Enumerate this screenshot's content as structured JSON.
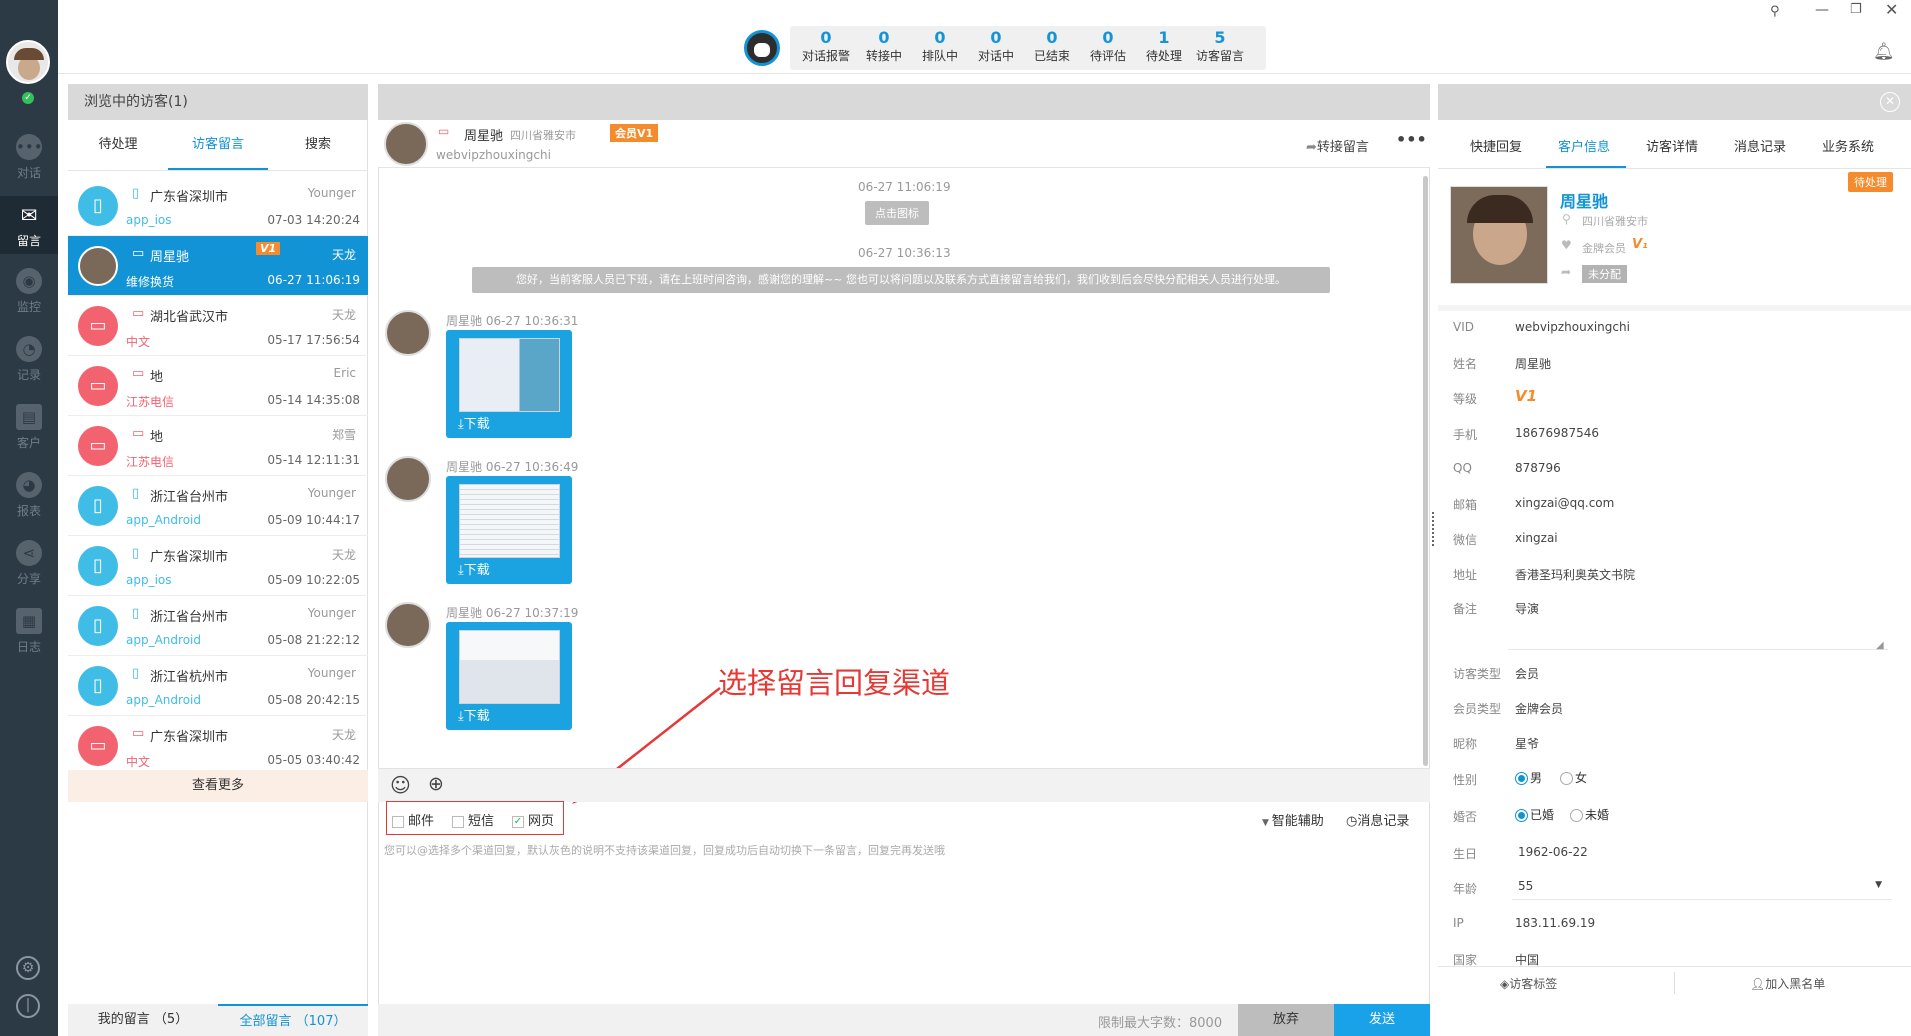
{
  "nav": {
    "items": [
      {
        "label": "对话",
        "icon": "chat-bubble-icon"
      },
      {
        "label": "留言",
        "icon": "mail-icon"
      },
      {
        "label": "监控",
        "icon": "eye-icon"
      },
      {
        "label": "记录",
        "icon": "clock-icon"
      },
      {
        "label": "客户",
        "icon": "contact-card-icon"
      },
      {
        "label": "报表",
        "icon": "pie-chart-icon"
      },
      {
        "label": "分享",
        "icon": "share-icon"
      },
      {
        "label": "日志",
        "icon": "clipboard-icon"
      }
    ]
  },
  "stats": [
    {
      "value": "0",
      "label": "对话报警"
    },
    {
      "value": "0",
      "label": "转接中"
    },
    {
      "value": "0",
      "label": "排队中"
    },
    {
      "value": "0",
      "label": "对话中"
    },
    {
      "value": "0",
      "label": "已结束"
    },
    {
      "value": "0",
      "label": "待评估"
    },
    {
      "value": "1",
      "label": "待处理"
    },
    {
      "value": "5",
      "label": "访客留言"
    }
  ],
  "left": {
    "header": "浏览中的访客(1)",
    "tabs": [
      "待处理",
      "访客留言",
      "搜索"
    ],
    "visitors": [
      {
        "device": "▯",
        "location": "广东省深圳市",
        "sub": "app_ios",
        "agent": "Younger",
        "time": "07-03 14:20:24",
        "type": "app"
      },
      {
        "device": "▭",
        "location": "周星驰",
        "sub": "维修换货",
        "agent": "天龙",
        "time": "06-27 11:06:19",
        "type": "photo",
        "badge": "V1"
      },
      {
        "device": "▭",
        "location": "湖北省武汉市",
        "sub": "中文",
        "agent": "天龙",
        "time": "05-17 17:56:54",
        "type": "pc"
      },
      {
        "device": "▭",
        "location": "地",
        "sub": "江苏电信",
        "agent": "Eric",
        "time": "05-14 14:35:08",
        "type": "pc"
      },
      {
        "device": "▭",
        "location": "地",
        "sub": "江苏电信",
        "agent": "郑雪",
        "time": "05-14 12:11:31",
        "type": "pc"
      },
      {
        "device": "▯",
        "location": "浙江省台州市",
        "sub": "app_Android",
        "agent": "Younger",
        "time": "05-09 10:44:17",
        "type": "app"
      },
      {
        "device": "▯",
        "location": "广东省深圳市",
        "sub": "app_ios",
        "agent": "天龙",
        "time": "05-09 10:22:05",
        "type": "app"
      },
      {
        "device": "▯",
        "location": "浙江省台州市",
        "sub": "app_Android",
        "agent": "Younger",
        "time": "05-08 21:22:12",
        "type": "app"
      },
      {
        "device": "▯",
        "location": "浙江省杭州市",
        "sub": "app_Android",
        "agent": "Younger",
        "time": "05-08 20:42:15",
        "type": "app"
      },
      {
        "device": "▭",
        "location": "广东省深圳市",
        "sub": "中文",
        "agent": "天龙",
        "time": "05-05 03:40:42",
        "type": "pc"
      }
    ],
    "more": "查看更多",
    "footer_mine": "我的留言 （5）",
    "footer_all": "全部留言 （107）"
  },
  "chat": {
    "name": "周星驰",
    "location": "四川省雅安市",
    "member_badge": "会员V1",
    "visitor_id": "webvipzhouxingchi",
    "transfer": "转接留言",
    "time1": "06-27 11:06:19",
    "click_icon": "点击图标",
    "time2": "06-27 10:36:13",
    "system_msg": "您好，当前客服人员已下班，请在上班时间咨询，感谢您的理解~~ 您也可以将问题以及联系方式直接留言给我们，我们收到后会尽快分配相关人员进行处理。",
    "messages": [
      {
        "sender": "周星驰 06-27 10:36:31",
        "download": "下载"
      },
      {
        "sender": "周星驰 06-27 10:36:49",
        "download": "下载"
      },
      {
        "sender": "周星驰 06-27 10:37:19",
        "download": "下载"
      }
    ],
    "annotation": "选择留言回复渠道",
    "channels": [
      "邮件",
      "短信",
      "网页"
    ],
    "assist": "智能辅助",
    "history": "消息记录",
    "hint": "您可以@选择多个渠道回复，默认灰色的说明不支持该渠道回复，回复成功后自动切换下一条留言，回复完再发送哦",
    "limit": "限制最大字数：8000",
    "abandon": "放弃",
    "send": "发送"
  },
  "right": {
    "tabs": [
      "快捷回复",
      "客户信息",
      "访客详情",
      "消息记录",
      "业务系统"
    ],
    "pending_badge": "待处理",
    "profile_name": "周星驰",
    "profile_location": "四川省雅安市",
    "profile_member": "金牌会员",
    "profile_assign": "未分配",
    "fields": [
      {
        "label": "VID",
        "value": "webvipzhouxingchi"
      },
      {
        "label": "姓名",
        "value": "周星驰"
      },
      {
        "label": "等级",
        "value": "V1"
      },
      {
        "label": "手机",
        "value": "18676987546"
      },
      {
        "label": "QQ",
        "value": "878796"
      },
      {
        "label": "邮箱",
        "value": "xingzai@qq.com"
      },
      {
        "label": "微信",
        "value": "xingzai"
      },
      {
        "label": "地址",
        "value": "香港圣玛利奥英文书院"
      },
      {
        "label": "备注",
        "value": "导演"
      }
    ],
    "fields2": [
      {
        "label": "访客类型",
        "value": "会员"
      },
      {
        "label": "会员类型",
        "value": "金牌会员"
      },
      {
        "label": "昵称",
        "value": "星爷"
      }
    ],
    "gender_label": "性别",
    "gender_male": "男",
    "gender_female": "女",
    "married_label": "婚否",
    "married_yes": "已婚",
    "married_no": "未婚",
    "birthday_label": "生日",
    "birthday": "1962-06-22",
    "age_label": "年龄",
    "age": "55",
    "ip_label": "IP",
    "ip": "183.11.69.19",
    "country_label": "国家",
    "country": "中国",
    "tag_btn": "访客标签",
    "blacklist_btn": "加入黑名单"
  }
}
